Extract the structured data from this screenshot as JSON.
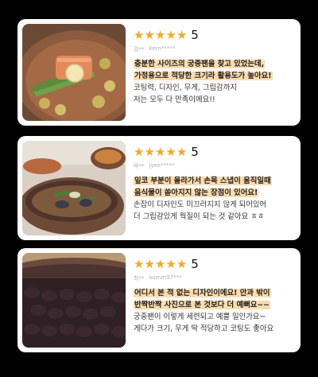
{
  "colors": {
    "star": "#f7a823",
    "highlight": "#fcdcae"
  },
  "reviews": [
    {
      "stars": 5,
      "star_glyph": "★",
      "score": "5",
      "user": "강**",
      "user_id": "kern*****",
      "highlight_lines": [
        "충분한 사이즈의 궁중팬을 찾고 있었는데,",
        "가정용으로 적당한 크기라 활용도가 높아요!"
      ],
      "text_lines": [
        "코팅력, 디자인, 무게, 그립감까지",
        "저는 모두 다 만족이에요!!"
      ],
      "photo": "salmon-steak-in-pan"
    },
    {
      "stars": 5,
      "star_glyph": "★",
      "score": "5",
      "user": "박**",
      "user_id": "jyee*****",
      "highlight_lines": [
        "잎코 부분이 올라가서 손목 스냅이 움직일때",
        "음식물이 쏟아지지 않는 장점이 있어요!"
      ],
      "text_lines": [
        "손잡이 디자인도 미끄러지지 않게 되어있어",
        "더 그립감있게 웍질이 되는 것 같아요 ㅎㅎ"
      ],
      "photo": "seafood-stew-in-pan"
    },
    {
      "stars": 5,
      "star_glyph": "★",
      "score": "5",
      "user": "최**",
      "user_id": "summ97***",
      "highlight_lines": [
        "어디서 본 적 없는 디자인이에요! 안과 밖이",
        "반짝반짝 사진으로  본 것보다 더 예뻐요~~"
      ],
      "text_lines": [
        "궁중팬이 이렇게 세련되고 예쁠 일인가요~",
        "게다가 크기, 무게 딱 적당하고 코팅도 좋아요"
      ],
      "photo": "empty-pan-closeup"
    }
  ]
}
